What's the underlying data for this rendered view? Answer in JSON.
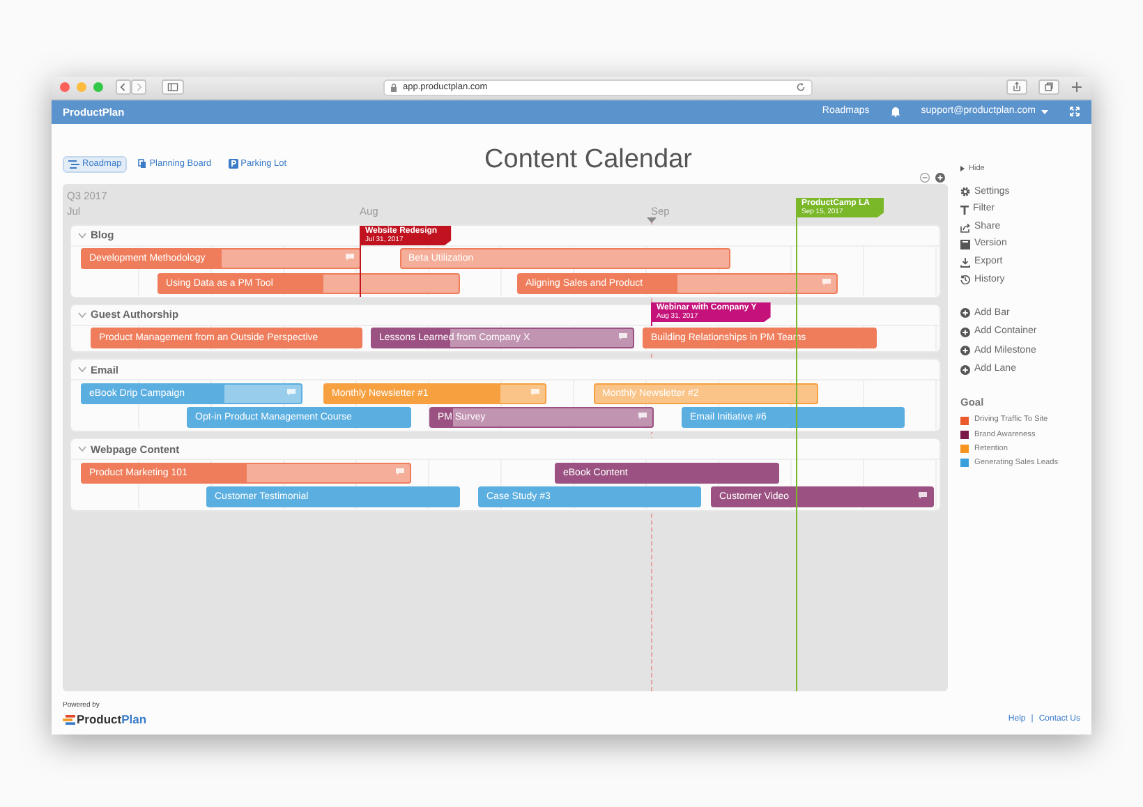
{
  "browser": {
    "url": "app.productplan.com"
  },
  "navbar": {
    "brand": "ProductPlan",
    "links": [
      "Roadmaps"
    ],
    "account": "support@productplan.com"
  },
  "views": [
    {
      "label": "Roadmap",
      "selected": true
    },
    {
      "label": "Planning Board",
      "selected": false
    },
    {
      "label": "Parking Lot",
      "selected": false
    }
  ],
  "title": "Content Calendar",
  "timeline": {
    "quarter": "Q3 2017",
    "months": [
      "Jul",
      "Aug",
      "Sep"
    ]
  },
  "milestones": [
    {
      "name": "Website Redesign",
      "date": "Jul 31, 2017",
      "color": "#c0121f"
    },
    {
      "name": "Webinar with Company Y",
      "date": "Aug 31, 2017",
      "color": "#c4127a"
    },
    {
      "name": "ProductCamp LA",
      "date": "Sep 15, 2017",
      "color": "#7ab829"
    }
  ],
  "lanes": [
    {
      "name": "Blog",
      "expanded": true,
      "rows": [
        [
          {
            "label": "Development Methodology",
            "color": "#ef7d5b",
            "level": 0.5,
            "comment": true
          },
          {
            "label": "Beta Utilization",
            "color": "#ef7d5b",
            "level": 0,
            "comment": false
          }
        ],
        [
          {
            "label": "Using Data as a PM Tool",
            "color": "#ef7d5b",
            "level": 0.55,
            "comment": false
          },
          {
            "label": "Aligning Sales and Product",
            "color": "#ef7d5b",
            "level": 0.5,
            "comment": true
          }
        ]
      ]
    },
    {
      "name": "Guest Authorship",
      "expanded": true,
      "rows": [
        [
          {
            "label": "Product Management from an Outside Perspective",
            "color": "#ef7d5b",
            "level": 1,
            "comment": false
          },
          {
            "label": "Lessons Learned from Company X",
            "color": "#9b5282",
            "level": 0.3,
            "comment": true
          },
          {
            "label": "Building Relationships in PM Teams",
            "color": "#ef7d5b",
            "level": 1,
            "comment": false
          }
        ]
      ]
    },
    {
      "name": "Email",
      "expanded": true,
      "rows": [
        [
          {
            "label": "eBook Drip Campaign",
            "color": "#5aaee0",
            "level": 0.65,
            "comment": true
          },
          {
            "label": "Monthly Newsletter #1",
            "color": "#f7a040",
            "level": 0.8,
            "comment": true
          },
          {
            "label": "Monthly Newsletter #2",
            "color": "#f7a040",
            "level": 0,
            "comment": false
          }
        ],
        [
          {
            "label": "Opt-in Product Management Course",
            "color": "#5aaee0",
            "level": 1,
            "comment": false
          },
          {
            "label": "PM Survey",
            "color": "#9b5282",
            "level": 0.1,
            "comment": true
          },
          {
            "label": "Email Initiative #6",
            "color": "#5aaee0",
            "level": 1,
            "comment": false
          }
        ]
      ]
    },
    {
      "name": "Webpage Content",
      "expanded": true,
      "rows": [
        [
          {
            "label": "Product Marketing 101",
            "color": "#ef7d5b",
            "level": 0.5,
            "comment": true
          },
          {
            "label": "eBook Content",
            "color": "#9b5282",
            "level": 1,
            "comment": false
          }
        ],
        [
          {
            "label": "Customer Testimonial",
            "color": "#5aaee0",
            "level": 1,
            "comment": false
          },
          {
            "label": "Case Study #3",
            "color": "#5aaee0",
            "level": 1,
            "comment": false
          },
          {
            "label": "Customer Video",
            "color": "#9b5282",
            "level": 1,
            "comment": true
          }
        ]
      ]
    }
  ],
  "sidebar": {
    "hide": "Hide",
    "actions": [
      "Settings",
      "Filter",
      "Share",
      "Version",
      "Export",
      "History"
    ],
    "add_actions": [
      "Add Bar",
      "Add Container",
      "Add Milestone",
      "Add Lane"
    ]
  },
  "legend": {
    "title": "Goal",
    "items": [
      {
        "label": "Driving Traffic To Site",
        "color": "#ea5a2c"
      },
      {
        "label": "Brand Awareness",
        "color": "#7a1848"
      },
      {
        "label": "Retention",
        "color": "#f7941d"
      },
      {
        "label": "Generating Sales Leads",
        "color": "#3aa0dc"
      }
    ]
  },
  "footer": {
    "powered_by": "Powered by",
    "logo": [
      "Product",
      "Plan"
    ],
    "links": [
      "Help",
      "Contact Us"
    ],
    "separator": "|"
  }
}
